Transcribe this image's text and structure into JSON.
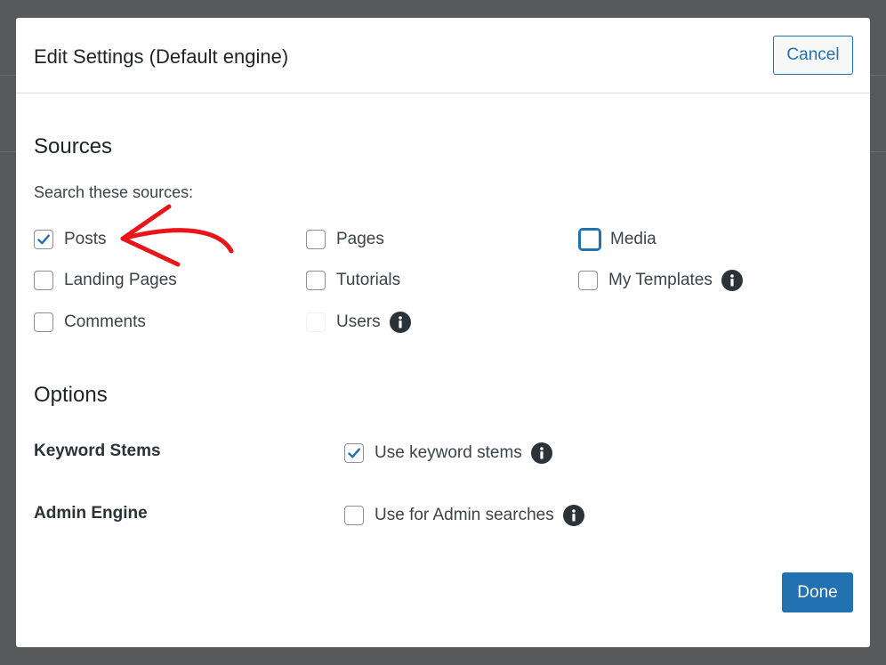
{
  "modal": {
    "title": "Edit Settings (Default engine)",
    "cancel_label": "Cancel",
    "done_label": "Done"
  },
  "sources": {
    "heading": "Sources",
    "search_label": "Search these sources:",
    "items": [
      {
        "label": "Posts",
        "checked": true
      },
      {
        "label": "Pages",
        "checked": false
      },
      {
        "label": "Media",
        "checked": false,
        "focused": true
      },
      {
        "label": "Landing Pages",
        "checked": false
      },
      {
        "label": "Tutorials",
        "checked": false
      },
      {
        "label": "My Templates",
        "checked": false,
        "info": true
      },
      {
        "label": "Comments",
        "checked": false
      },
      {
        "label": "Users",
        "checked": false,
        "info": true
      }
    ]
  },
  "options": {
    "heading": "Options",
    "keyword_stems": {
      "label": "Keyword Stems",
      "checkbox_label": "Use keyword stems",
      "checked": true
    },
    "admin_engine": {
      "label": "Admin Engine",
      "checkbox_label": "Use for Admin searches",
      "checked": false
    }
  },
  "colors": {
    "accent": "#2271b1",
    "annotation_arrow": "#e8161b"
  }
}
